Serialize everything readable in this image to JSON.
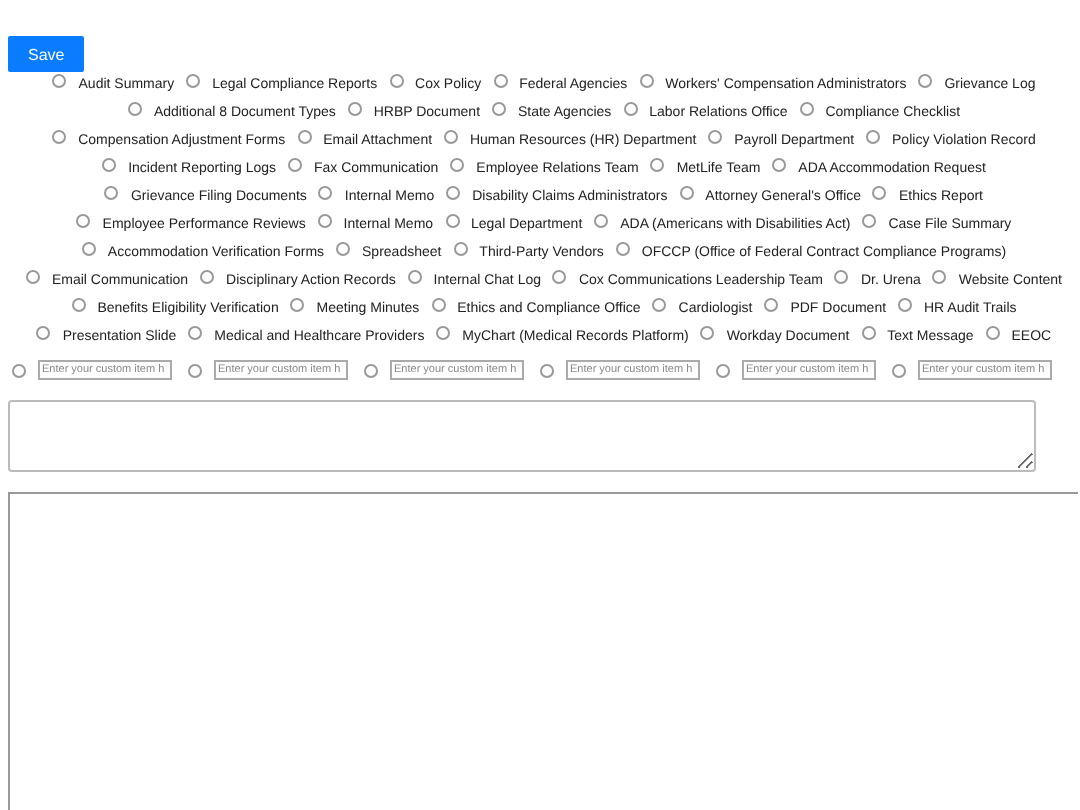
{
  "save_button": {
    "label": "Save"
  },
  "options": [
    {
      "label": "Audit Summary",
      "selected": false
    },
    {
      "label": "Legal Compliance Reports",
      "selected": false
    },
    {
      "label": "Cox Policy",
      "selected": false
    },
    {
      "label": "Federal Agencies",
      "selected": false
    },
    {
      "label": "Workers' Compensation Administrators",
      "selected": false
    },
    {
      "label": "Grievance Log",
      "selected": false
    },
    {
      "label": "Additional 8 Document Types",
      "selected": false
    },
    {
      "label": "HRBP Document",
      "selected": false
    },
    {
      "label": "State Agencies",
      "selected": false
    },
    {
      "label": "Labor Relations Office",
      "selected": false
    },
    {
      "label": "Compliance Checklist",
      "selected": false
    },
    {
      "label": "Compensation Adjustment Forms",
      "selected": false
    },
    {
      "label": "Email Attachment",
      "selected": false
    },
    {
      "label": "Human Resources (HR) Department",
      "selected": false
    },
    {
      "label": "Payroll Department",
      "selected": false
    },
    {
      "label": "Policy Violation Record",
      "selected": false
    },
    {
      "label": "Incident Reporting Logs",
      "selected": false
    },
    {
      "label": "Fax Communication",
      "selected": false
    },
    {
      "label": "Employee Relations Team",
      "selected": false
    },
    {
      "label": "MetLife Team",
      "selected": false
    },
    {
      "label": "ADA Accommodation Request",
      "selected": false
    },
    {
      "label": "Grievance Filing Documents",
      "selected": false
    },
    {
      "label": "Internal Memo",
      "selected": false
    },
    {
      "label": "Disability Claims Administrators",
      "selected": false
    },
    {
      "label": "Attorney General's Office",
      "selected": false
    },
    {
      "label": "Ethics Report",
      "selected": false
    },
    {
      "label": "Employee Performance Reviews",
      "selected": false
    },
    {
      "label": "Internal Memo",
      "selected": false
    },
    {
      "label": "Legal Department",
      "selected": false
    },
    {
      "label": "ADA (Americans with Disabilities Act)",
      "selected": false
    },
    {
      "label": "Case File Summary",
      "selected": false
    },
    {
      "label": "Accommodation Verification Forms",
      "selected": false
    },
    {
      "label": "Spreadsheet",
      "selected": false
    },
    {
      "label": "Third-Party Vendors",
      "selected": false
    },
    {
      "label": "OFCCP (Office of Federal Contract Compliance Programs)",
      "selected": false
    },
    {
      "label": "Email Communication",
      "selected": false
    },
    {
      "label": "Disciplinary Action Records",
      "selected": false
    },
    {
      "label": "Internal Chat Log",
      "selected": false
    },
    {
      "label": "Cox Communications Leadership Team",
      "selected": false
    },
    {
      "label": "Dr. Urena",
      "selected": false
    },
    {
      "label": "Website Content",
      "selected": false
    },
    {
      "label": "Benefits Eligibility Verification",
      "selected": false
    },
    {
      "label": "Meeting Minutes",
      "selected": false
    },
    {
      "label": "Ethics and Compliance Office",
      "selected": false
    },
    {
      "label": "Cardiologist",
      "selected": false
    },
    {
      "label": "PDF Document",
      "selected": false
    },
    {
      "label": "HR Audit Trails",
      "selected": false
    },
    {
      "label": "Presentation Slide",
      "selected": false
    },
    {
      "label": "Medical and Healthcare Providers",
      "selected": false
    },
    {
      "label": "MyChart (Medical Records Platform)",
      "selected": false
    },
    {
      "label": "Workday Document",
      "selected": false
    },
    {
      "label": "Text Message",
      "selected": false
    },
    {
      "label": "EEOC",
      "selected": false
    }
  ],
  "custom_items": [
    {
      "placeholder": "Enter your custom item h",
      "selected": false
    },
    {
      "placeholder": "Enter your custom item h",
      "selected": false
    },
    {
      "placeholder": "Enter your custom item h",
      "selected": false
    },
    {
      "placeholder": "Enter your custom item h",
      "selected": false
    },
    {
      "placeholder": "Enter your custom item h",
      "selected": false
    },
    {
      "placeholder": "Enter your custom item h",
      "selected": false
    }
  ]
}
